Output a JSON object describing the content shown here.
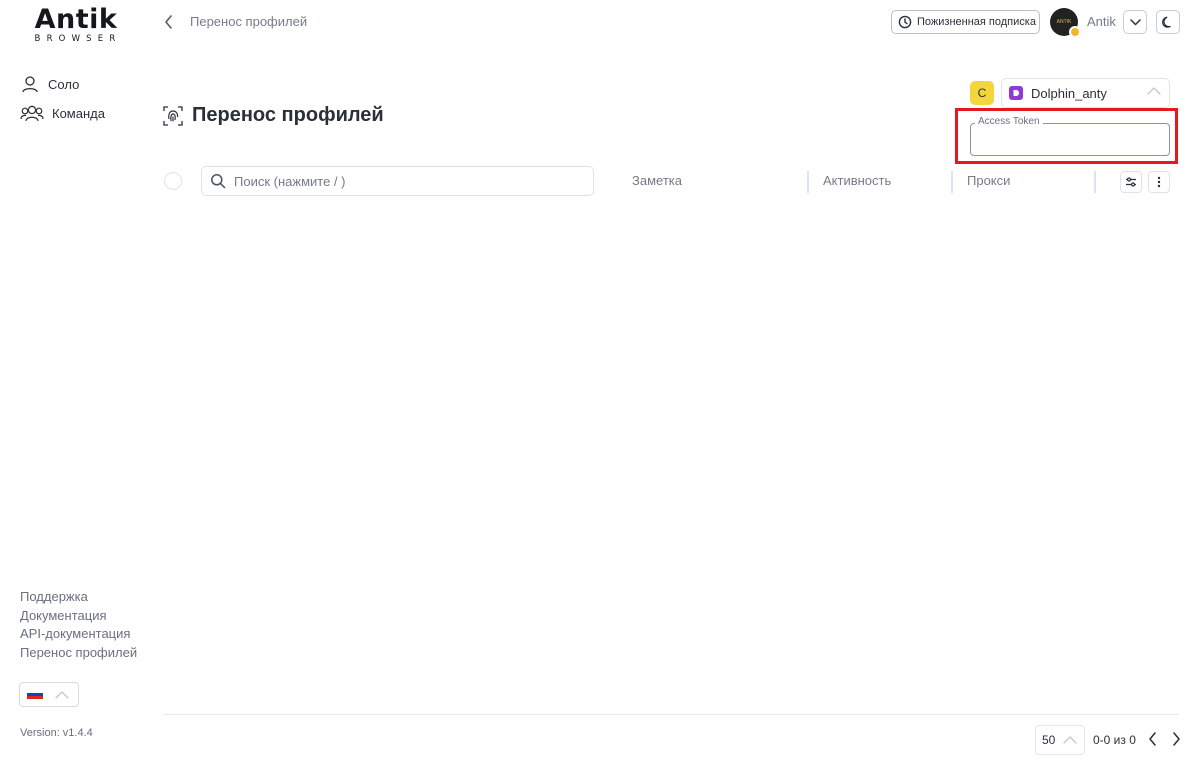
{
  "brand": {
    "logo_main": "Antik",
    "logo_sub": "BROWSER"
  },
  "header": {
    "breadcrumb": "Перенос профилей",
    "subscription_label": "Пожизненная подписка",
    "avatar_text": "ANTIK",
    "user_name": "Antik"
  },
  "sidebar": {
    "items": [
      {
        "label": "Соло",
        "icon": "user-icon"
      },
      {
        "label": "Команда",
        "icon": "users-icon"
      }
    ],
    "footer_links": [
      "Поддержка",
      "Документация",
      "API-документация",
      "Перенос профилей"
    ],
    "language": "ru",
    "version": "Version: v1.4.4"
  },
  "main": {
    "title": "Перенос профилей",
    "refresh_label": "C",
    "service": {
      "name": "Dolphin_anty"
    },
    "access_token": {
      "label": "Access Token",
      "value": ""
    },
    "search": {
      "placeholder": "Поиск (нажмите / )"
    },
    "columns": [
      "Заметка",
      "Активность",
      "Прокси"
    ]
  },
  "pagination": {
    "per_page": "50",
    "range": "0-0 из 0"
  },
  "colors": {
    "accent_yellow": "#f4d53c",
    "dolphin_purple": "#8e3bd1",
    "highlight_red": "#e5181e"
  }
}
